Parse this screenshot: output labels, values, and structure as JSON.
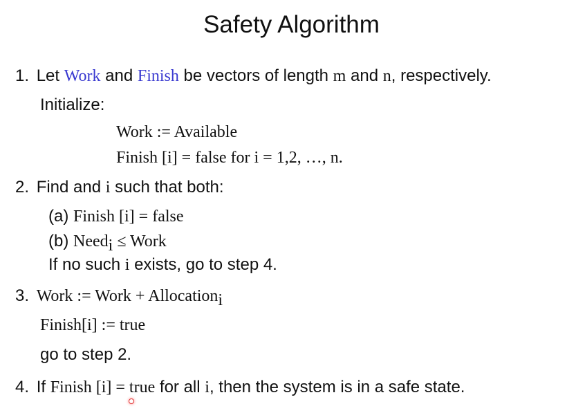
{
  "title": "Safety Algorithm",
  "step1": {
    "num": "1.",
    "t1": "Let ",
    "work": "Work",
    "t2": " and ",
    "finish": "Finish",
    "t3": " be vectors of length ",
    "m": "m",
    "t4": " and ",
    "n": "n",
    "t5": ", respectively.",
    "init": "Initialize:",
    "c1": "Work := Available",
    "c2": "Finish [i] = false for i = 1,2, …, n."
  },
  "step2": {
    "num": "2.",
    "t1": "Find and ",
    "i": "i",
    "t2": " such that both:",
    "a_label": "(a) ",
    "a": "Finish [i] = false",
    "b_label": "(b) ",
    "b1": "Need",
    "b_sub": "i",
    "b2": " ≤ Work",
    "t3": "If no such ",
    "i2": "i",
    "t4": " exists, go to step 4."
  },
  "step3": {
    "num": "3.",
    "c1": "Work := Work + Allocation",
    "c1_sub": "i",
    "c2": "Finish[i] := true",
    "goto": "go to step 2."
  },
  "step4": {
    "num": "4.",
    "t1": "If ",
    "c1": "Finish [i] = true",
    "t2": " for all ",
    "i": "i",
    "t3": ", then the system is in a safe state."
  },
  "colors": {
    "keyword": "#3a3ad0",
    "cursor": "#e03030"
  }
}
